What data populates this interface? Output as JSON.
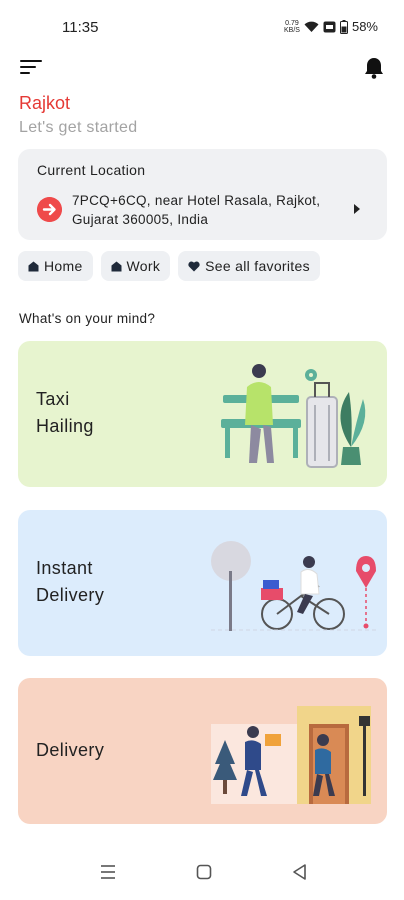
{
  "status_bar": {
    "time": "11:35",
    "net_speed_top": "0.79",
    "net_speed_bottom": "KB/S",
    "battery": "58%"
  },
  "header": {
    "city": "Rajkot",
    "subtitle": "Let's get started"
  },
  "location": {
    "label": "Current Location",
    "address": "7PCQ+6CQ, near Hotel Rasala, Rajkot, Gujarat 360005, India"
  },
  "favorites": [
    {
      "label": "Home",
      "icon": "home-icon"
    },
    {
      "label": "Work",
      "icon": "work-icon"
    },
    {
      "label": "See all favorites",
      "icon": "heart-icon"
    }
  ],
  "section_title": "What's on your mind?",
  "services": [
    {
      "label": "Taxi\nHailing",
      "color": "#e7f4cf"
    },
    {
      "label": "Instant\nDelivery",
      "color": "#dcecfc"
    },
    {
      "label": "Delivery",
      "color": "#f8d4c3"
    }
  ],
  "colors": {
    "accent": "#e53935",
    "muted_text": "#a3a3a3",
    "card_bg": "#f0f1f3"
  }
}
